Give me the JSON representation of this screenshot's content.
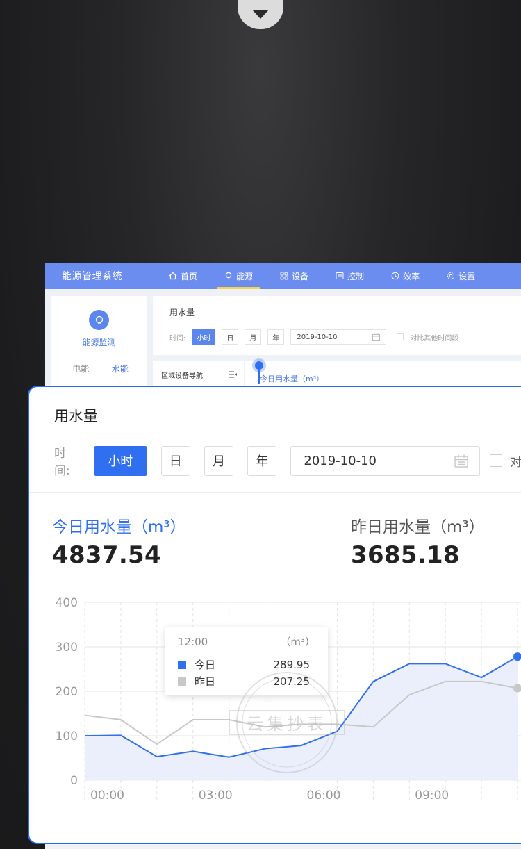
{
  "background_app": {
    "brand": "能源管理系统",
    "nav": [
      {
        "label": "首页",
        "icon": "home-icon"
      },
      {
        "label": "能源",
        "icon": "bulb-icon",
        "active": true
      },
      {
        "label": "设备",
        "icon": "grid-icon"
      },
      {
        "label": "控制",
        "icon": "monitor-icon"
      },
      {
        "label": "效率",
        "icon": "clock-icon"
      },
      {
        "label": "设置",
        "icon": "gear-icon"
      }
    ],
    "sidebar": {
      "title": "能源监测",
      "tabs": [
        "电能",
        "水能"
      ],
      "active_tab": "水能"
    },
    "filter": {
      "title": "用水量",
      "time_label": "时间:",
      "buttons": [
        "小时",
        "日",
        "月",
        "年"
      ],
      "date": "2019-10-10",
      "compare_label": "对比其他时间段"
    },
    "region_nav_label": "区域设备导航",
    "today_label": "今日用水量（m³）"
  },
  "card": {
    "title": "用水量",
    "time_label": "时间:",
    "buttons": [
      "小时",
      "日",
      "月",
      "年"
    ],
    "active_button": "小时",
    "date": "2019-10-10",
    "compare_label": "对比",
    "today": {
      "label": "今日用水量（m³）",
      "value": "4837.54"
    },
    "yesterday": {
      "label": "昨日用水量（m³）",
      "value": "3685.18"
    },
    "tooltip": {
      "time": "12:00",
      "unit": "（m³）",
      "rows": [
        {
          "name": "今日",
          "value": "289.95"
        },
        {
          "name": "昨日",
          "value": "207.25"
        }
      ]
    }
  },
  "colors": {
    "accent": "#2f6ff0",
    "nav_bg": "#6b8def",
    "yesterday_series": "#c8c8c8",
    "today_fill": "#e8edfb"
  },
  "chart_data": {
    "type": "area",
    "ylim": [
      0,
      400
    ],
    "yticks": [
      0,
      100,
      200,
      300,
      400
    ],
    "x": [
      0,
      1,
      2,
      3,
      4,
      5,
      6,
      7,
      8,
      9,
      10,
      11,
      12
    ],
    "xtick_labels": {
      "0": "00:00",
      "3": "03:00",
      "6": "06:00",
      "9": "09:00"
    },
    "series": [
      {
        "name": "今日",
        "color": "#2f6ff0",
        "values": [
          100,
          101,
          53,
          65,
          52,
          71,
          78,
          110,
          222,
          262,
          262,
          231,
          278
        ]
      },
      {
        "name": "昨日",
        "color": "#c8c8c8",
        "values": [
          146,
          136,
          81,
          136,
          136,
          120,
          126,
          126,
          120,
          192,
          222,
          222,
          207
        ]
      }
    ],
    "grid": true
  }
}
